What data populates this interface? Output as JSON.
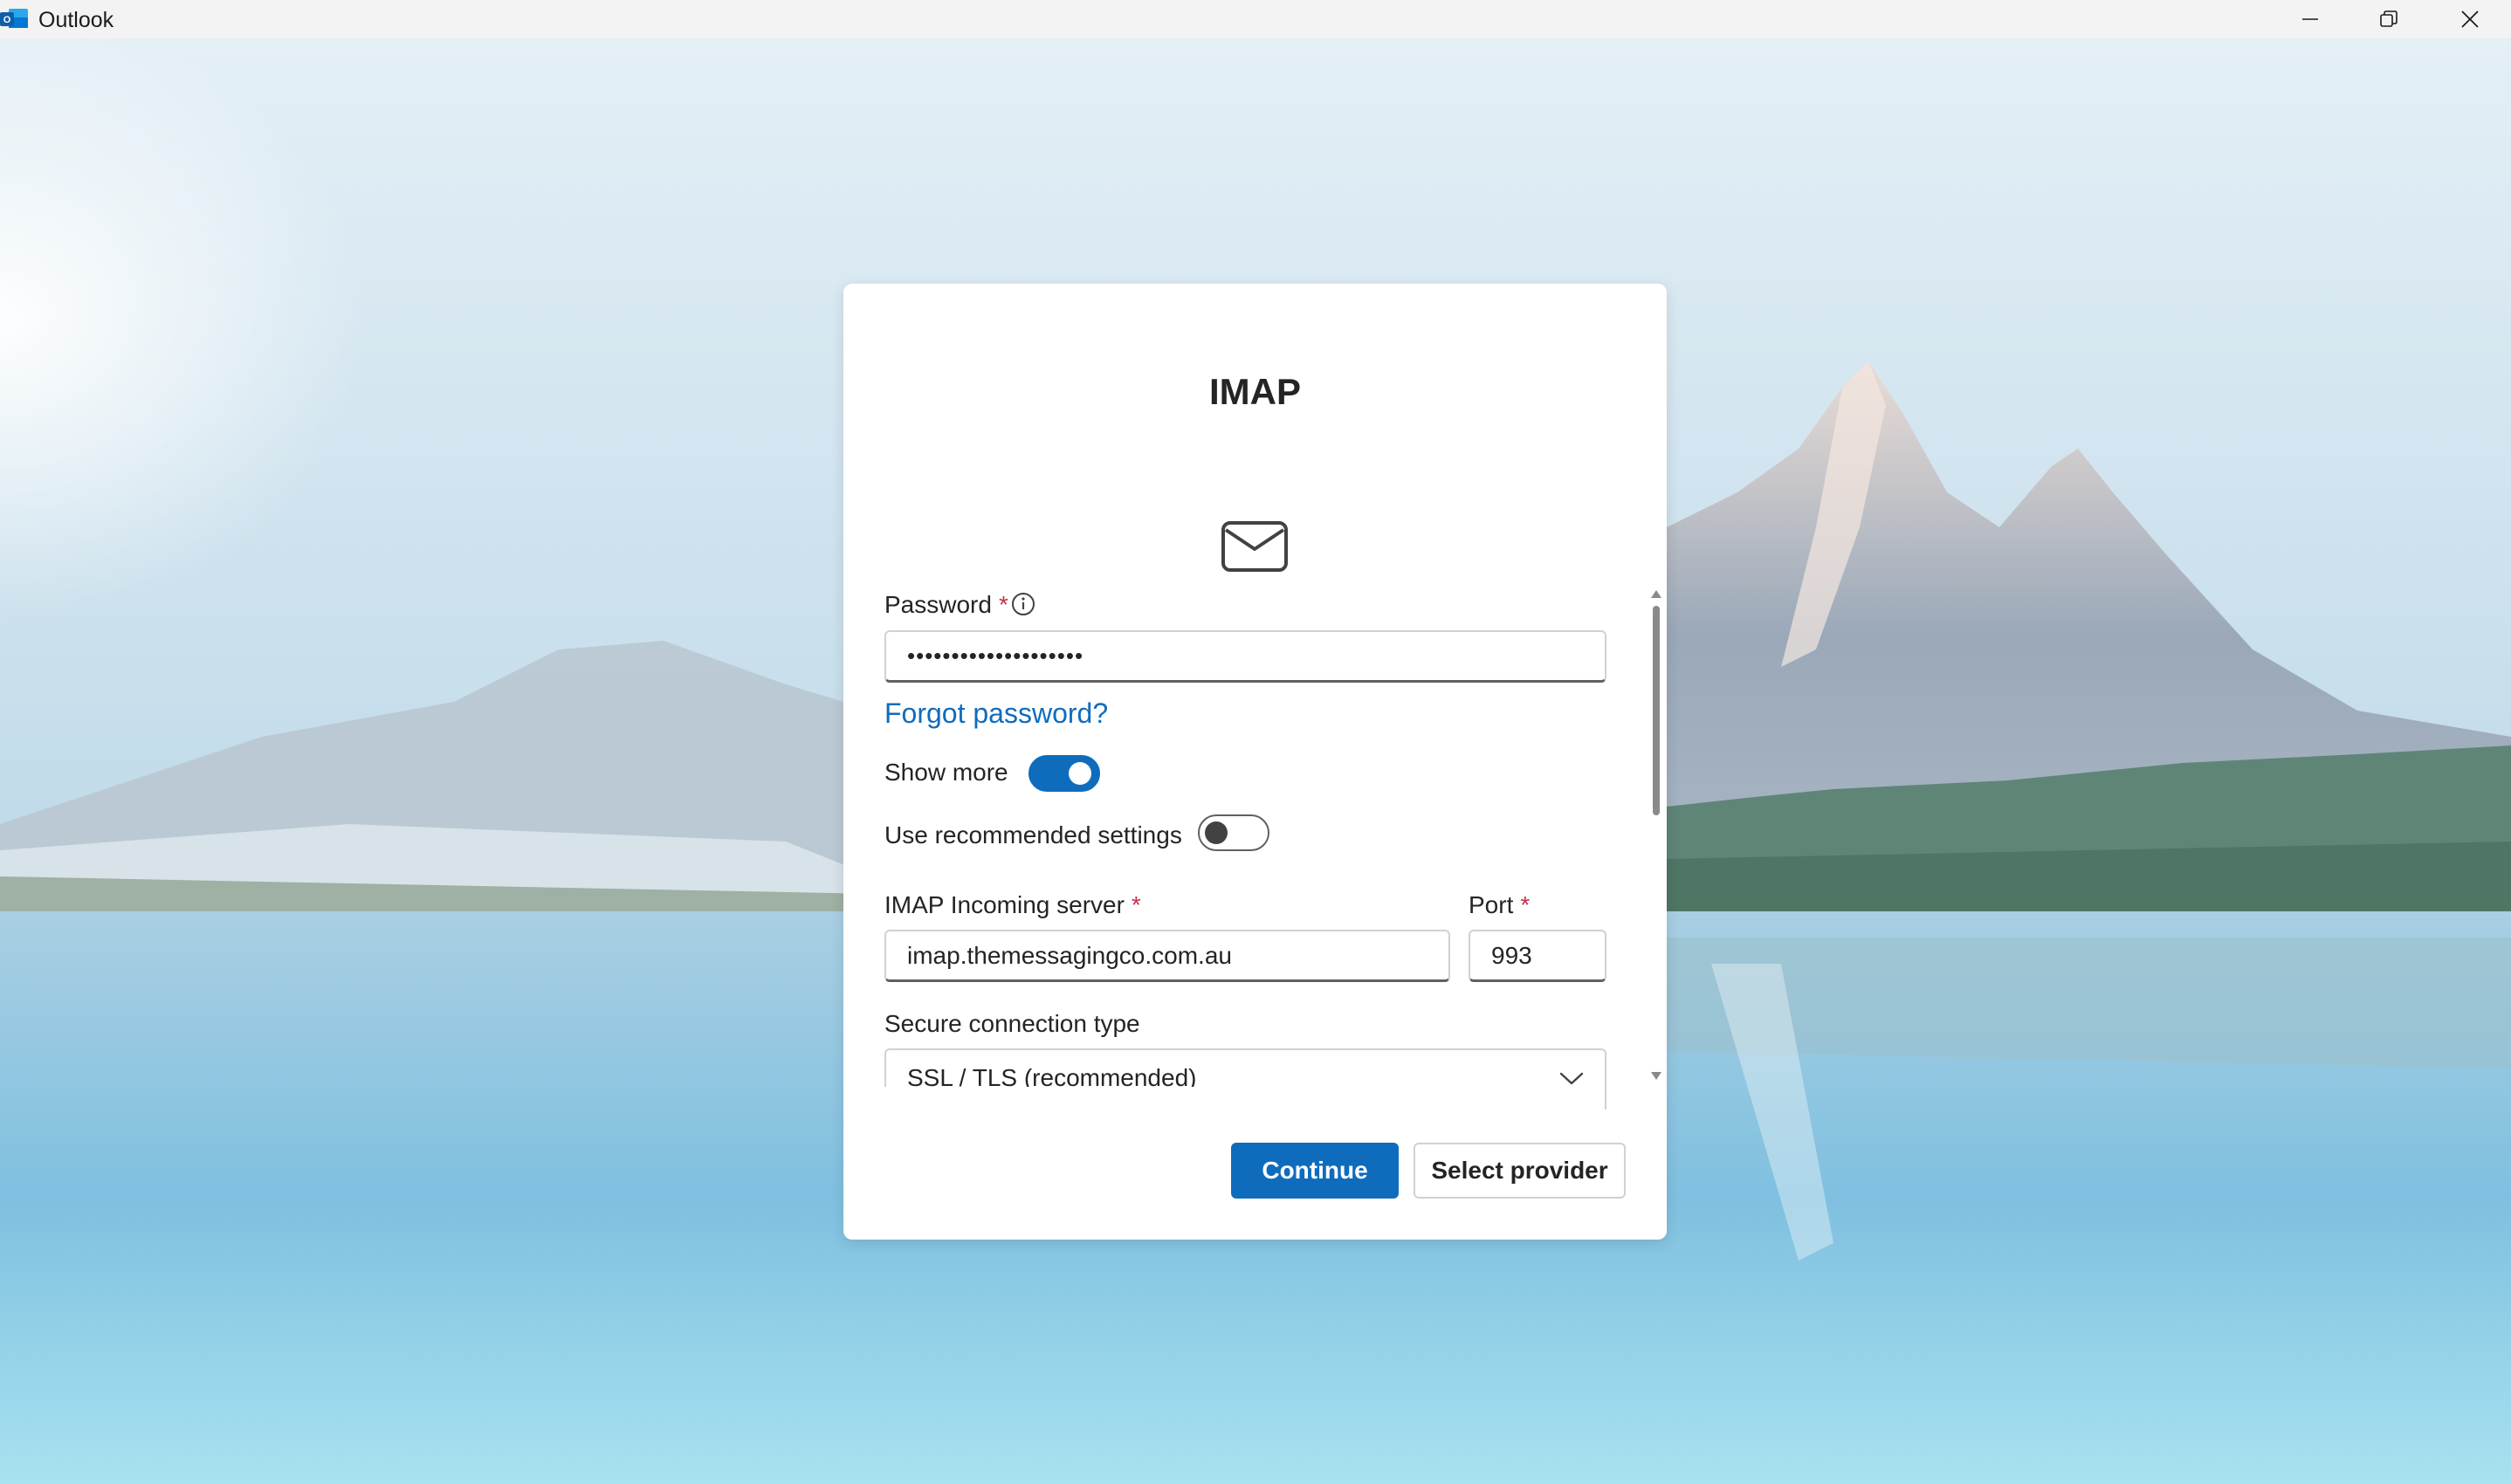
{
  "window": {
    "app_name": "Outlook",
    "controls": {
      "minimize": "minimize",
      "restore": "restore",
      "close": "close"
    }
  },
  "dialog": {
    "title": "IMAP",
    "header_icon": "mail-icon",
    "password": {
      "label": "Password",
      "required_marker": "*",
      "info_icon": "info-icon",
      "masked_value": "••••••••••••••••••••"
    },
    "forgot_password_link": "Forgot password?",
    "show_more": {
      "label": "Show more",
      "state": "on"
    },
    "use_recommended": {
      "label": "Use recommended settings",
      "state": "off"
    },
    "incoming_server": {
      "label": "IMAP Incoming server",
      "required_marker": "*",
      "value": "imap.themessagingco.com.au"
    },
    "port": {
      "label": "Port",
      "required_marker": "*",
      "value": "993"
    },
    "secure_connection": {
      "label": "Secure connection type",
      "selected": "SSL / TLS (recommended)"
    },
    "buttons": {
      "continue": "Continue",
      "select_provider": "Select provider"
    }
  },
  "colors": {
    "accent": "#0f6cbd",
    "required": "#c4314b",
    "text": "#242424"
  }
}
